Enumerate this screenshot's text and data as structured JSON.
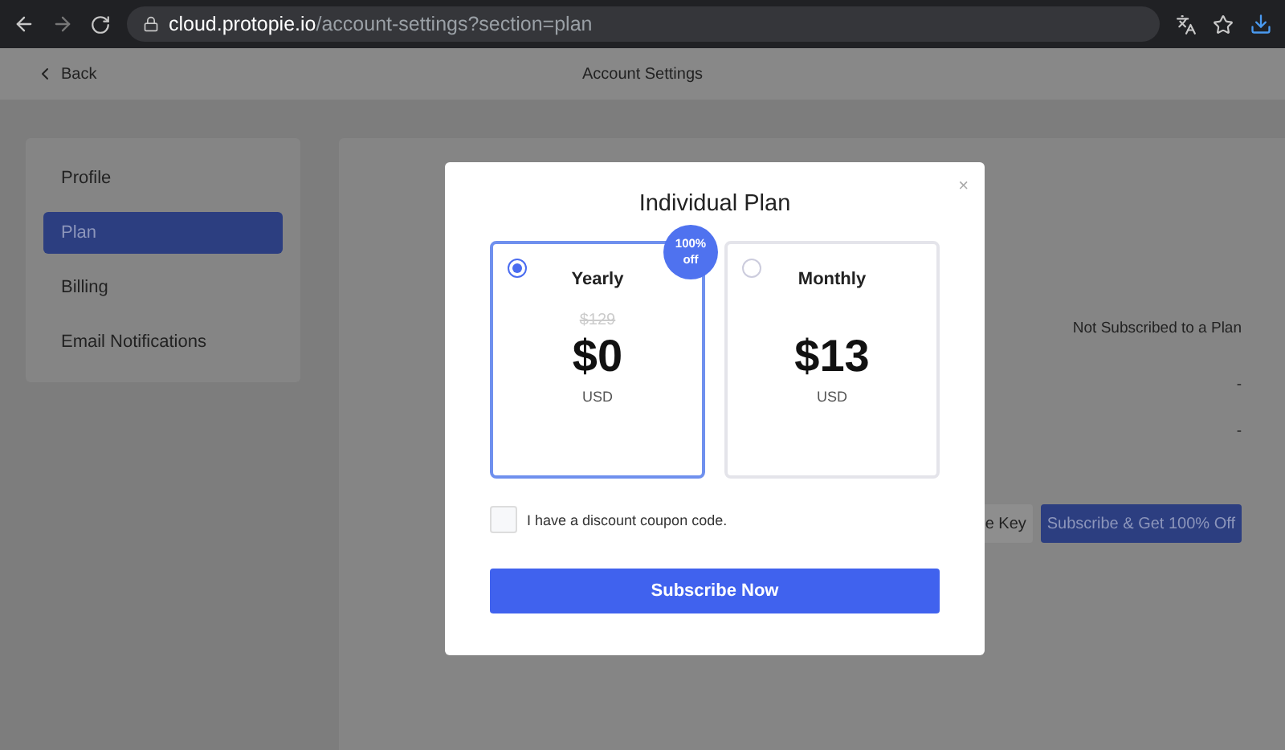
{
  "browser": {
    "url_host": "cloud.protopie.io",
    "url_path": "/account-settings?section=plan"
  },
  "header": {
    "back": "Back",
    "title": "Account Settings"
  },
  "sidebar": {
    "items": [
      {
        "label": "Profile",
        "selected": false
      },
      {
        "label": "Plan",
        "selected": true
      },
      {
        "label": "Billing",
        "selected": false
      },
      {
        "label": "Email Notifications",
        "selected": false
      }
    ]
  },
  "main": {
    "status": "Not Subscribed to a Plan",
    "values": [
      "-",
      "-"
    ],
    "buttons": [
      {
        "label": "e Key",
        "kind": "secondary"
      },
      {
        "label": "Subscribe & Get 100% Off",
        "kind": "primary"
      }
    ]
  },
  "modal": {
    "title": "Individual Plan",
    "close": "×",
    "plans": [
      {
        "name": "Yearly",
        "selected": true,
        "badge": [
          "100%",
          "off"
        ],
        "old_price": "$129",
        "price": "$0",
        "currency": "USD"
      },
      {
        "name": "Monthly",
        "selected": false,
        "price": "$13",
        "currency": "USD"
      }
    ],
    "coupon": {
      "label": "I have a discount coupon code.",
      "checked": false
    },
    "submit": "Subscribe Now"
  }
}
